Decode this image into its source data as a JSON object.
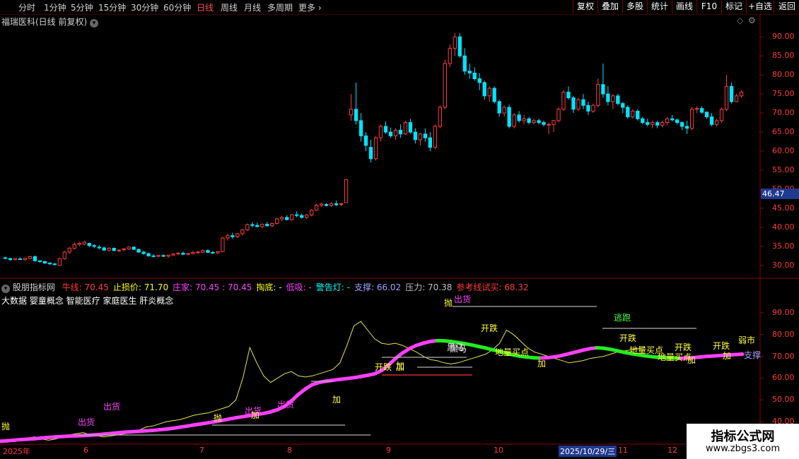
{
  "toolbar": {
    "periods": [
      "分时",
      "1分钟",
      "5分钟",
      "15分钟",
      "30分钟",
      "60分钟",
      "日线",
      "周线",
      "月线",
      "多周期",
      "更多"
    ],
    "active_period": "日线",
    "right_buttons": [
      "复权",
      "叠加",
      "多股",
      "统计",
      "画线",
      "F10",
      "标记",
      "+自选",
      "返回"
    ]
  },
  "main_panel": {
    "title": "福瑞医科(日线 前复权)",
    "current_price": "46.47",
    "y_ticks": [
      "90.00",
      "85.00",
      "80.00",
      "75.00",
      "70.00",
      "65.00",
      "60.00",
      "55.00",
      "50.00",
      "45.00",
      "40.00",
      "35.00",
      "30.00"
    ]
  },
  "indicator_panel": {
    "name": "股朋指标网",
    "readouts": [
      {
        "label": "牛线:",
        "value": "70.45",
        "color": "#ff3b3b"
      },
      {
        "label": "止损价:",
        "value": "71.70",
        "color": "#ffff00"
      },
      {
        "label": "庄家:",
        "value": "70.45 : 70.45",
        "color": "#ff40ff"
      },
      {
        "label": "掏底:",
        "value": "-",
        "color": "#ffff00"
      },
      {
        "label": "低吸:",
        "value": "-",
        "color": "#ff40ff"
      },
      {
        "label": "警告灯:",
        "value": "-",
        "color": "#00ffff"
      },
      {
        "label": "支撑:",
        "value": "66.02",
        "color": "#a0a0ff"
      },
      {
        "label": "压力:",
        "value": "70.38",
        "color": "#c0c0c0"
      },
      {
        "label": "参考线试买:",
        "value": "68.32",
        "color": "#ff3b3b"
      }
    ],
    "concepts": "大数据 婴童概念 智能医疗 家庭医生 肝炎概念",
    "y_ticks": [
      "90.00",
      "80.00",
      "70.00",
      "60.00",
      "50.00",
      "40.00"
    ],
    "signals": [
      "抛",
      "出货",
      "出货",
      "抛",
      "出货",
      "出货",
      "加",
      "加",
      "加",
      "开跌",
      "黑马",
      "抛",
      "出货",
      "黑马",
      "开跌",
      "地量买点",
      "加",
      "开跌",
      "逃跑",
      "地量买点",
      "开跌",
      "加",
      "地量买点",
      "开跌",
      "加",
      "弱市",
      "支撑",
      "加"
    ]
  },
  "x_axis": {
    "labels": [
      "2025年",
      "6",
      "7",
      "8",
      "9",
      "10",
      "2025/10/29/三",
      "11",
      "12"
    ]
  },
  "watermark": {
    "title": "指标公式网",
    "url": "www.zbgs3.com"
  },
  "colors": {
    "up": "#ff3b3b",
    "down": "#00e5ff",
    "bull": "#ff40ff",
    "bear": "#22ee22",
    "bg": "#000000"
  },
  "chart_data": {
    "type": "candlestick",
    "title": "福瑞医科(日线 前复权)",
    "ylim": [
      27,
      93
    ],
    "ohlc": [
      [
        32,
        32.3,
        31.6,
        31.9
      ],
      [
        31.8,
        32,
        31.2,
        31.5
      ],
      [
        31.5,
        31.9,
        31.3,
        31.8
      ],
      [
        31.7,
        32.1,
        31.4,
        31.5
      ],
      [
        31.5,
        32,
        31.2,
        31.9
      ],
      [
        31.8,
        32.5,
        31.6,
        32.3
      ],
      [
        32.3,
        32.6,
        31,
        31.2
      ],
      [
        31.2,
        31.3,
        30.7,
        31
      ],
      [
        31,
        31.2,
        30.4,
        30.6
      ],
      [
        30.6,
        30.8,
        30.1,
        30.4
      ],
      [
        30.4,
        30.6,
        30,
        30.2
      ],
      [
        30,
        32,
        29.8,
        31.8
      ],
      [
        31.8,
        33.8,
        31.5,
        33.5
      ],
      [
        33.5,
        34.8,
        33,
        34.5
      ],
      [
        34.5,
        36,
        34.2,
        35.5
      ],
      [
        35.5,
        36.2,
        35,
        35.8
      ],
      [
        35.6,
        36.4,
        35.3,
        36.1
      ],
      [
        35.8,
        36,
        34.8,
        35.2
      ],
      [
        35.2,
        35.6,
        34.5,
        35
      ],
      [
        34.8,
        35.3,
        34.2,
        34.6
      ],
      [
        34.6,
        34.9,
        33.8,
        34
      ],
      [
        34,
        34.8,
        33.6,
        34.5
      ],
      [
        34.5,
        34.7,
        33.7,
        33.9
      ],
      [
        33.9,
        34.2,
        33.5,
        34
      ],
      [
        34.2,
        34.6,
        33.7,
        34.3
      ],
      [
        34.3,
        35,
        34,
        34.8
      ],
      [
        34.8,
        35,
        34.1,
        34.2
      ],
      [
        34.2,
        34.4,
        33.3,
        33.5
      ],
      [
        33.5,
        33.8,
        32.8,
        33.1
      ],
      [
        33.1,
        33.4,
        32.3,
        32.5
      ],
      [
        32.5,
        32.9,
        32.1,
        32.4
      ],
      [
        32.4,
        32.8,
        32.1,
        32.6
      ],
      [
        32.6,
        32.9,
        32.2,
        32.4
      ],
      [
        32.4,
        32.8,
        32,
        32.7
      ],
      [
        32.7,
        33.2,
        32.5,
        33
      ],
      [
        33,
        33.5,
        32.7,
        33.2
      ],
      [
        33.2,
        33.6,
        32.8,
        32.9
      ],
      [
        32.9,
        33.3,
        32.6,
        33.1
      ],
      [
        33.1,
        33.7,
        32.9,
        33.4
      ],
      [
        33.4,
        33.9,
        33.1,
        33.5
      ],
      [
        33.5,
        34.1,
        33.2,
        33.9
      ],
      [
        33.9,
        34.2,
        33.3,
        33.4
      ],
      [
        33.4,
        33.8,
        33,
        33.3
      ],
      [
        33.3,
        33.8,
        33,
        33.6
      ],
      [
        33.6,
        37.5,
        33.5,
        37.2
      ],
      [
        37.2,
        38.3,
        36.5,
        37.8
      ],
      [
        37.8,
        38.6,
        37,
        37.5
      ],
      [
        37.5,
        38.5,
        37.2,
        38.3
      ],
      [
        38.3,
        39.6,
        37.8,
        39.3
      ],
      [
        39.3,
        41,
        39,
        40.7
      ],
      [
        40.7,
        41.4,
        40,
        40.5
      ],
      [
        40.5,
        41.2,
        39.9,
        40.2
      ],
      [
        40.2,
        41,
        39.7,
        40.8
      ],
      [
        40.8,
        41.4,
        40.2,
        40.4
      ],
      [
        40.4,
        41.2,
        40,
        41
      ],
      [
        41,
        42.5,
        40.8,
        42.2
      ],
      [
        42.2,
        43,
        41.6,
        42.6
      ],
      [
        42.6,
        43.2,
        41.8,
        42
      ],
      [
        42,
        43.5,
        41.7,
        43.3
      ],
      [
        43.3,
        44.2,
        42.6,
        43.1
      ],
      [
        43.1,
        43.6,
        42.3,
        42.6
      ],
      [
        42.6,
        43.5,
        42.2,
        43.2
      ],
      [
        43.2,
        44.8,
        42.9,
        44.5
      ],
      [
        44.5,
        46.2,
        44.3,
        45.8
      ],
      [
        45.8,
        46.5,
        45.3,
        46.1
      ],
      [
        46,
        46.4,
        45.5,
        45.7
      ],
      [
        45.7,
        46.6,
        45.4,
        46.2
      ],
      [
        46.2,
        47,
        45.6,
        45.9
      ],
      [
        46,
        46.4,
        45.5,
        46.2
      ],
      [
        46.5,
        52.5,
        46.5,
        52.5
      ],
      [
        69.5,
        75,
        68,
        71
      ],
      [
        71,
        78,
        67,
        68
      ],
      [
        68,
        70,
        62.5,
        64
      ],
      [
        64,
        65,
        60,
        61.5
      ],
      [
        61,
        63,
        57,
        58
      ],
      [
        58,
        64,
        57.5,
        63.5
      ],
      [
        63.5,
        67,
        62.5,
        66.5
      ],
      [
        66.5,
        67.8,
        64.5,
        65
      ],
      [
        65,
        66.2,
        63.5,
        64
      ],
      [
        64,
        66,
        63,
        65.5
      ],
      [
        65.5,
        67,
        63.5,
        64.5
      ],
      [
        64.5,
        68,
        64.2,
        67.5
      ],
      [
        67.5,
        68.5,
        64.5,
        65
      ],
      [
        65,
        66,
        62,
        63
      ],
      [
        63,
        64.8,
        61.5,
        64.5
      ],
      [
        64.5,
        66,
        62.5,
        63.5
      ],
      [
        63.5,
        65,
        60,
        61
      ],
      [
        61,
        67,
        60.5,
        66.5
      ],
      [
        66.5,
        72,
        66,
        71.5
      ],
      [
        71.5,
        84,
        71,
        83
      ],
      [
        83,
        88,
        82,
        87
      ],
      [
        87,
        91,
        85,
        90
      ],
      [
        90,
        91,
        84.5,
        85
      ],
      [
        85,
        87,
        80,
        81
      ],
      [
        81,
        83,
        79,
        80.5
      ],
      [
        80.5,
        82,
        78.5,
        79
      ],
      [
        79,
        80.5,
        76,
        78
      ],
      [
        78,
        78.5,
        73.5,
        74.5
      ],
      [
        74.5,
        77,
        73,
        76.5
      ],
      [
        76.5,
        77,
        72.5,
        73
      ],
      [
        73,
        73.5,
        69,
        70
      ],
      [
        70,
        72,
        69,
        71.5
      ],
      [
        71.5,
        72.2,
        66,
        66.5
      ],
      [
        66.5,
        70,
        66,
        69.5
      ],
      [
        69.5,
        70.5,
        67.5,
        68
      ],
      [
        68,
        69.5,
        67,
        68.5
      ],
      [
        68.5,
        69,
        67,
        67.5
      ],
      [
        67.5,
        68.5,
        67,
        68
      ],
      [
        68,
        68.5,
        67,
        67.5
      ],
      [
        67.5,
        68,
        66.5,
        67
      ],
      [
        67,
        67.5,
        64.5,
        67
      ],
      [
        67,
        68.2,
        65,
        68
      ],
      [
        68,
        71.5,
        67.5,
        71
      ],
      [
        71,
        76,
        70.5,
        75.5
      ],
      [
        75.5,
        77,
        73.5,
        74
      ],
      [
        74,
        74.5,
        70,
        71
      ],
      [
        71,
        74,
        70.5,
        73.5
      ],
      [
        73.5,
        75,
        71,
        72
      ],
      [
        72,
        73,
        69.5,
        70.5
      ],
      [
        70.5,
        72.5,
        70,
        72
      ],
      [
        72,
        79,
        71.5,
        77.5
      ],
      [
        77.5,
        83,
        74,
        75
      ],
      [
        75,
        77,
        72,
        73
      ],
      [
        73,
        75,
        71,
        74.5
      ],
      [
        74.5,
        75,
        72,
        72.5
      ],
      [
        72.5,
        73,
        70,
        71.5
      ],
      [
        71.5,
        72,
        68.5,
        69
      ],
      [
        69,
        71,
        68.5,
        70.5
      ],
      [
        70.5,
        71,
        68,
        68.5
      ],
      [
        68.5,
        69,
        67,
        67.5
      ],
      [
        67.5,
        68.5,
        66.5,
        67
      ],
      [
        67,
        68,
        66,
        67.5
      ],
      [
        67.5,
        68,
        66,
        66.8
      ],
      [
        66.8,
        68,
        66.2,
        67.5
      ],
      [
        67.5,
        69,
        66.8,
        68.5
      ],
      [
        68.5,
        69.5,
        67.8,
        68.2
      ],
      [
        68.2,
        68.5,
        67,
        67.5
      ],
      [
        67.5,
        67.8,
        65.5,
        66.5
      ],
      [
        66.5,
        68,
        64.5,
        66
      ],
      [
        66,
        71.5,
        65.5,
        71
      ],
      [
        71,
        71.8,
        70,
        71.2
      ],
      [
        71.2,
        71.8,
        69.8,
        70.2
      ],
      [
        70.2,
        70.5,
        68.5,
        69
      ],
      [
        69,
        70,
        66.5,
        67
      ],
      [
        67,
        68.5,
        66.5,
        68
      ],
      [
        68,
        71.5,
        67.5,
        71
      ],
      [
        71,
        80,
        70.5,
        77
      ],
      [
        77,
        78,
        72.5,
        73
      ],
      [
        73,
        75,
        72.8,
        74.5
      ],
      [
        74.5,
        76,
        74,
        75.5
      ]
    ],
    "indicator": {
      "ylim": [
        30,
        100
      ],
      "series": [
        {
          "name": "庄家",
          "values": [
            31,
            31.2,
            31.5,
            31.8,
            32,
            32.2,
            32.5,
            32.8,
            33,
            33.2,
            33.4,
            33.5,
            33.6,
            33.8,
            34,
            34.3,
            34.6,
            34.9,
            35.2,
            35.4,
            35.6,
            35.8,
            36,
            36.3,
            36.6,
            37,
            37.5,
            38,
            38.5,
            39,
            39.5,
            40,
            40.6,
            41.2,
            41.8,
            42.3,
            42.8,
            43.3,
            43.8,
            44.5,
            45.5,
            47,
            49.5,
            52.5,
            55,
            57,
            58,
            58.6,
            59,
            59.4,
            59.8,
            60.2,
            60.7,
            61.3,
            62,
            63.5,
            66,
            69,
            71.5,
            73.5,
            75,
            76,
            76.8,
            77.2,
            77.1,
            76.8,
            76.3,
            75.8,
            75.2,
            74.5,
            73.8,
            73,
            72.2,
            71.4,
            70.6,
            70,
            69.6,
            69.3,
            69.2,
            69.4,
            69.8,
            70.4,
            71.2,
            72,
            72.8,
            73.5,
            73.9,
            73.7,
            73.2,
            72.5,
            71.8,
            71.2,
            70.7,
            70.2,
            69.8,
            69.5,
            69.3,
            69.2,
            69.1,
            69.2,
            69.4,
            69.7,
            70,
            70.2,
            70.4,
            70.6,
            70.8,
            71
          ]
        },
        {
          "name": "价格",
          "values": [
            31,
            31.5,
            31,
            31.8,
            32.5,
            33,
            32,
            31.5,
            32,
            33,
            34,
            34.5,
            35,
            34,
            33.5,
            33,
            33.5,
            34,
            34.5,
            35,
            36,
            37.5,
            38,
            39,
            40,
            40.5,
            41,
            42,
            43,
            43.5,
            44,
            45,
            46,
            47,
            50,
            60,
            74,
            67,
            61,
            58,
            60,
            62,
            63,
            61,
            60.5,
            61,
            62,
            63,
            64,
            67,
            75,
            84,
            86,
            82,
            78,
            76,
            75.5,
            76,
            75,
            73.5,
            72,
            70,
            68.5,
            68,
            67,
            66.5,
            67,
            68,
            69,
            70,
            71,
            73,
            76,
            82,
            80,
            77,
            74,
            72,
            71,
            70,
            69,
            68,
            67,
            67.5,
            68,
            69,
            69.5,
            70,
            71,
            72,
            72.5,
            73,
            73.5,
            74
          ]
        }
      ]
    }
  }
}
